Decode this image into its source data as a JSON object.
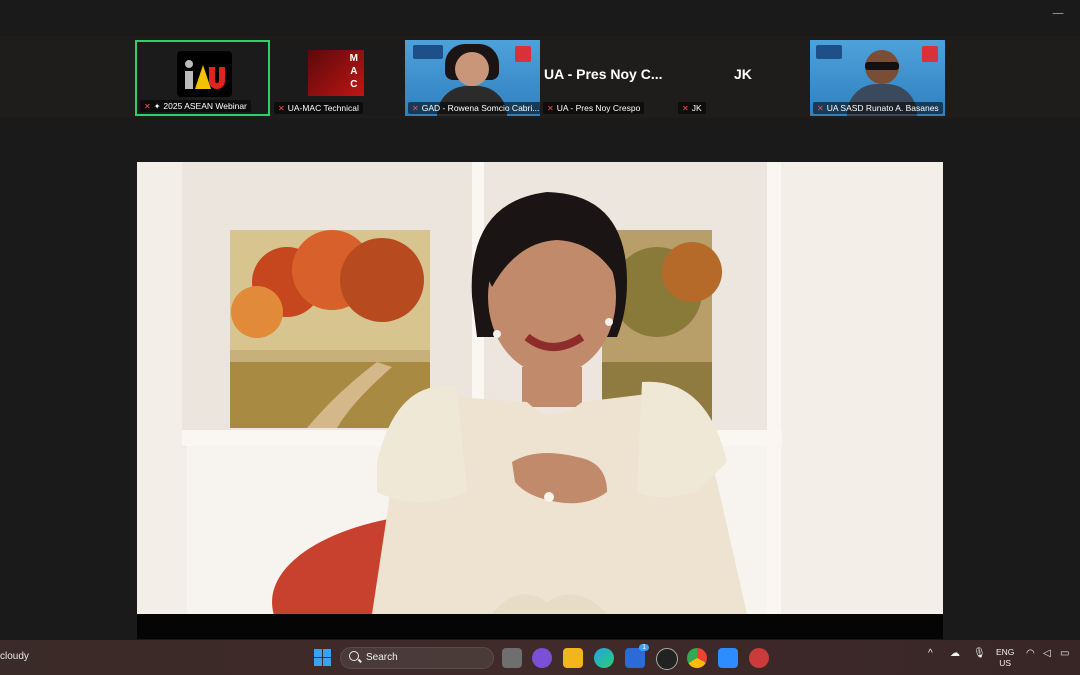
{
  "participants": [
    {
      "label": "2025 ASEAN Webinar",
      "active": true
    },
    {
      "label": "UA-MAC Technical",
      "active": false
    },
    {
      "label": "GAD - Rowena Somcio Cabri...",
      "active": false
    },
    {
      "label": "UA - Pres Noy Crespo",
      "active": false,
      "display_name": "UA - Pres Noy C..."
    },
    {
      "label": "JK",
      "active": false,
      "display_name": "JK"
    },
    {
      "label": "UA SASD Runato A. Basanes",
      "active": false
    }
  ],
  "mac_letters": [
    "M",
    "A",
    "C"
  ],
  "taskbar": {
    "weather": "cloudy",
    "search_label": "Search",
    "lang_top": "ENG",
    "lang_bottom": "US",
    "store_badge": "1"
  },
  "colors": {
    "active_border": "#2fd06b",
    "muted": "#ff4d4d",
    "taskbar": "#3a2a28"
  }
}
